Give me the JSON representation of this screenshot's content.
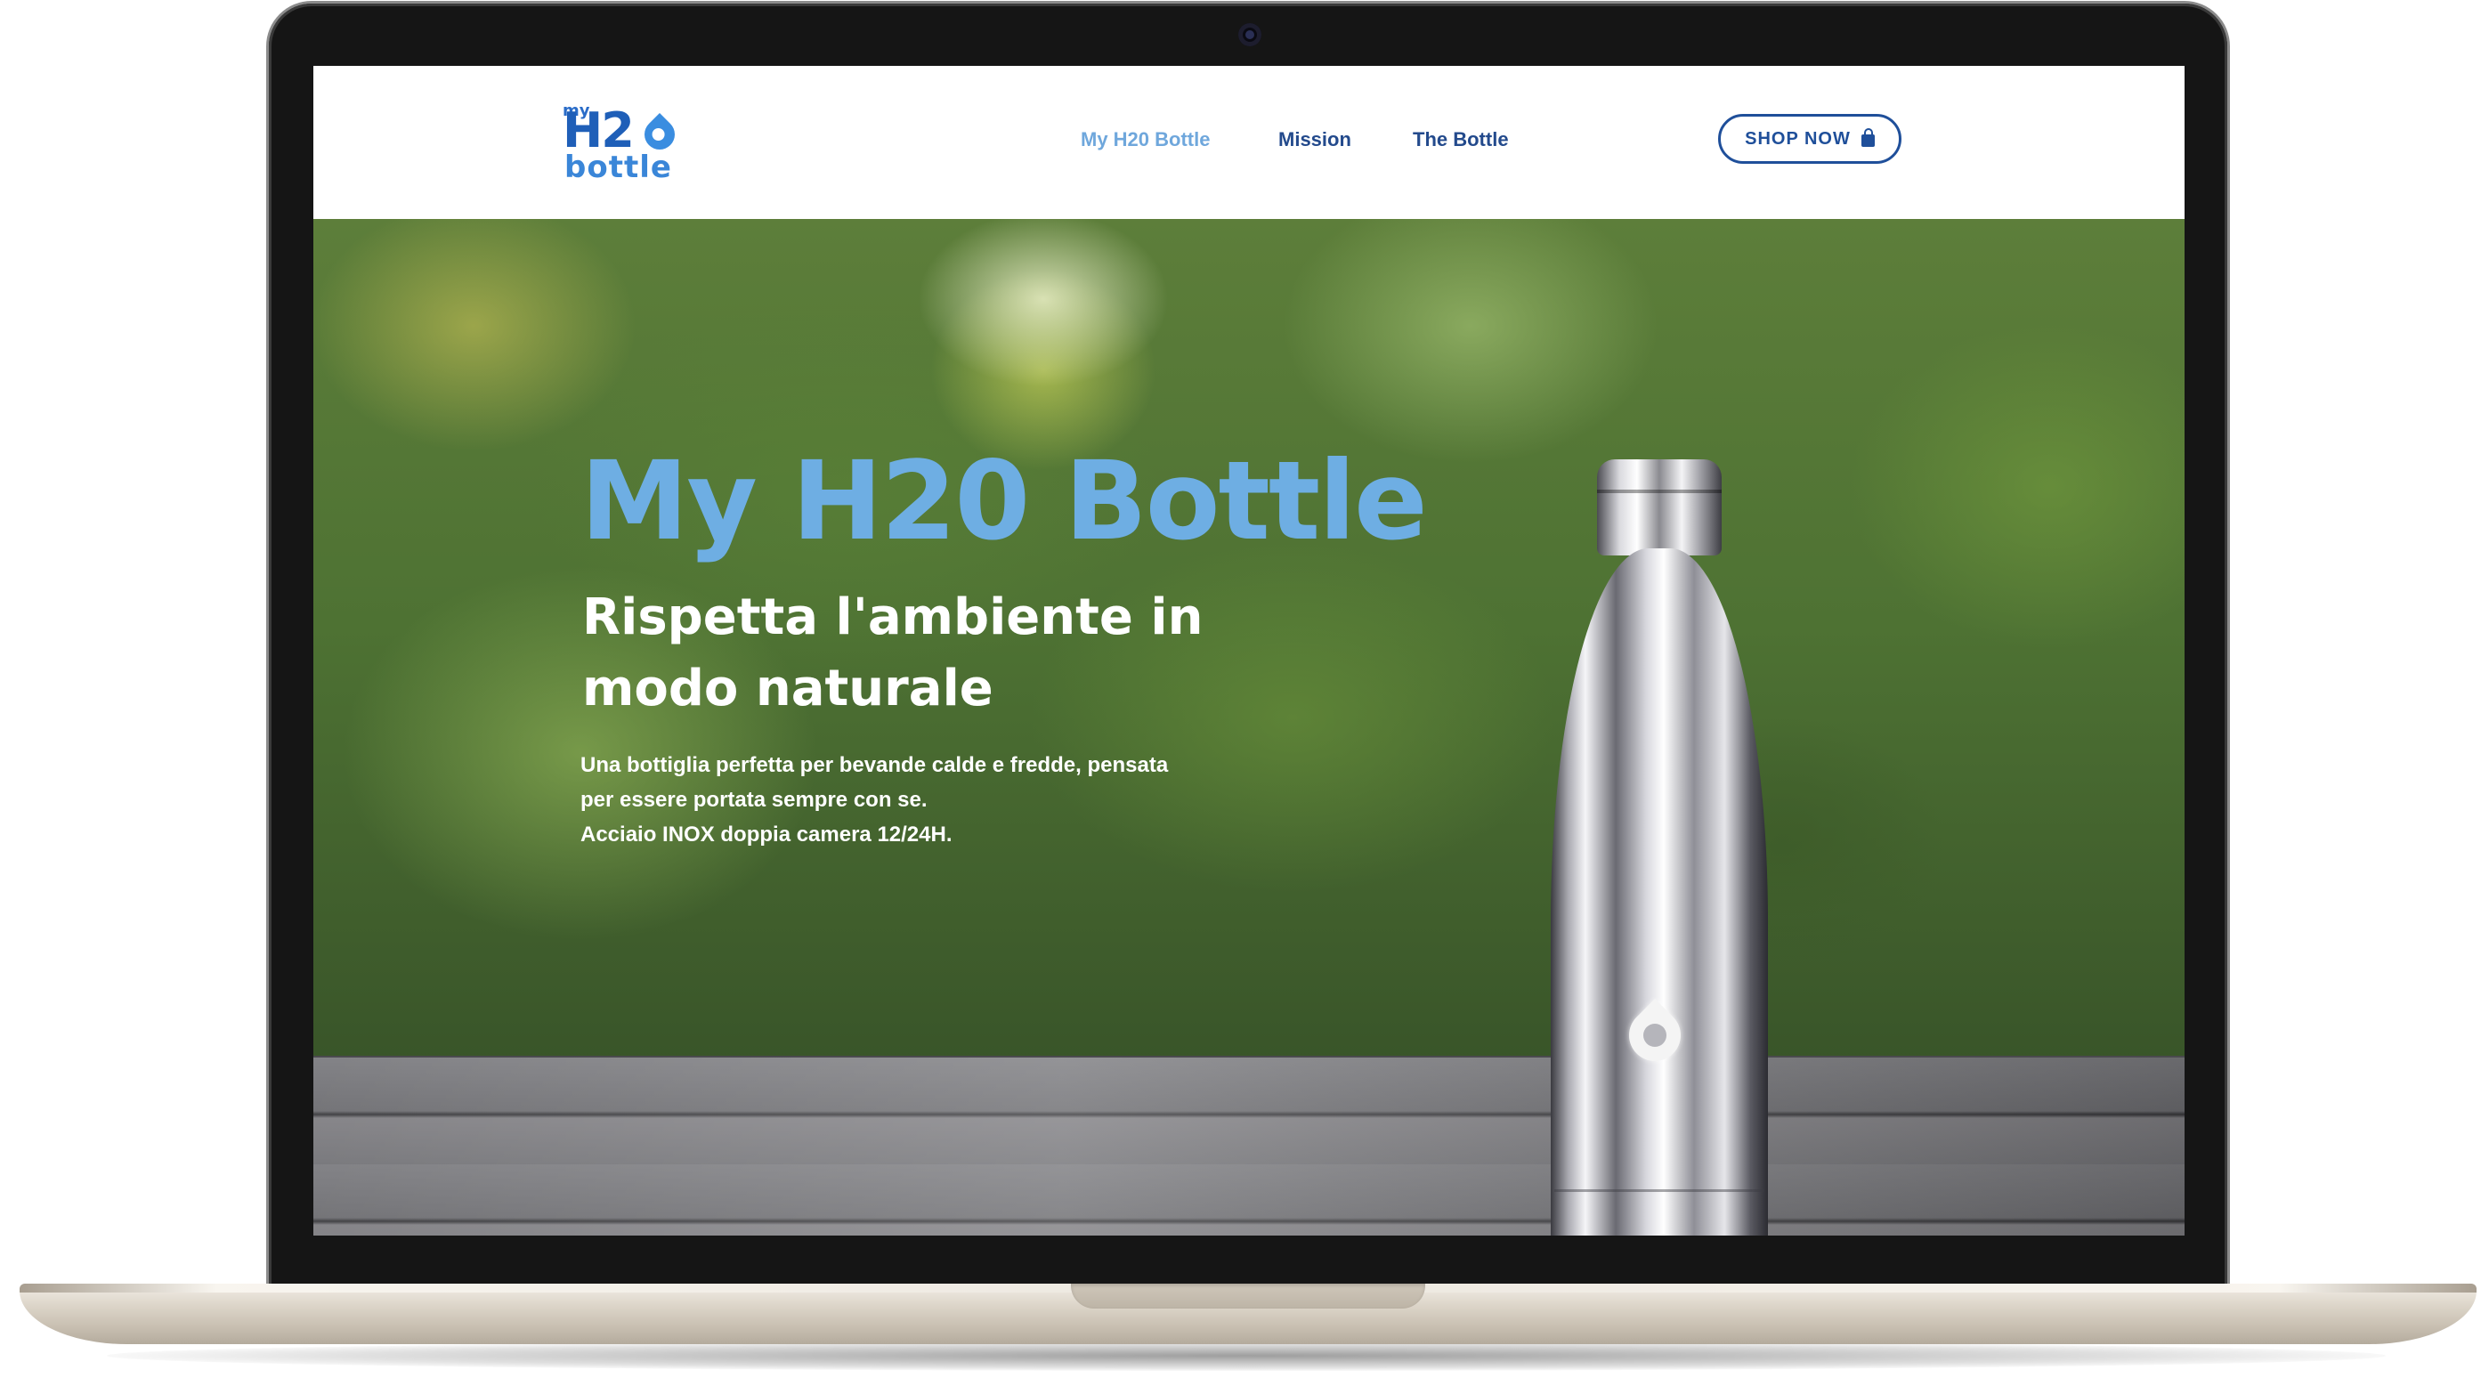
{
  "brand": {
    "logo_my": "my",
    "logo_h2o": "H2",
    "logo_bottle": "bottle"
  },
  "nav": {
    "items": [
      {
        "label": "My H20 Bottle",
        "active": true
      },
      {
        "label": "Mission",
        "active": false
      },
      {
        "label": "The Bottle",
        "active": false
      }
    ],
    "shop_button": "SHOP NOW"
  },
  "hero": {
    "title": "My H20 Bottle",
    "subtitle": "Rispetta l'ambiente in modo naturale",
    "description_lines": [
      "Una bottiglia perfetta per bevande calde e fredde, pensata",
      "per essere portata sempre con se.",
      "Acciaio INOX doppia camera 12/24H."
    ]
  },
  "colors": {
    "title_blue": "#6eaee3",
    "nav_blue": "#234a8c",
    "nav_active": "#6fa7dc",
    "button_border": "#1f4f9a"
  },
  "icons": [
    "camera-icon",
    "bag-icon",
    "water-drop-icon"
  ]
}
